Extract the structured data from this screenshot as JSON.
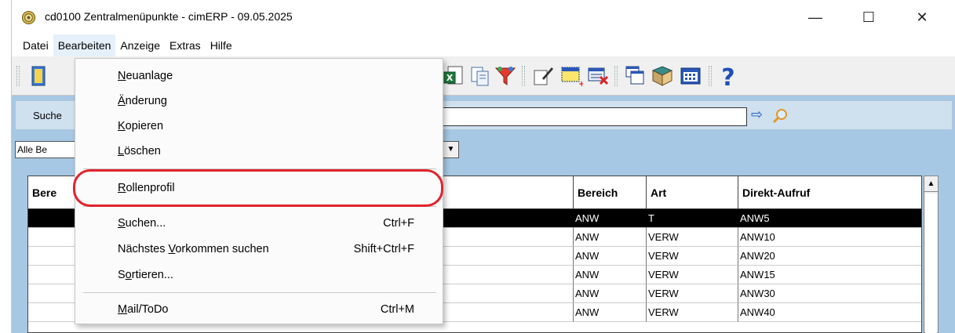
{
  "window": {
    "title": "cd0100 Zentralmenüpunkte - cimERP - 09.05.2025",
    "minimize_glyph": "—",
    "maximize_glyph": "☐",
    "close_glyph": "✕"
  },
  "menubar": {
    "items": [
      "Datei",
      "Bearbeiten",
      "Anzeige",
      "Extras",
      "Hilfe"
    ],
    "active": "Bearbeiten"
  },
  "dropdown": {
    "items": [
      {
        "label": "Neuanlage",
        "underline_char": "N",
        "shortcut": ""
      },
      {
        "label": "Änderung",
        "underline_char": "Ä",
        "shortcut": ""
      },
      {
        "label": "Kopieren",
        "underline_char": "K",
        "shortcut": ""
      },
      {
        "label": "Löschen",
        "underline_char": "L",
        "shortcut": ""
      },
      {
        "label": "Rollenprofil",
        "underline_char": "R",
        "shortcut": ""
      },
      {
        "label": "Suchen...",
        "underline_char": "S",
        "shortcut": "Ctrl+F"
      },
      {
        "label": "Nächstes Vorkommen suchen",
        "underline_char": "V",
        "shortcut": "Shift+Ctrl+F"
      },
      {
        "label": "Sortieren...",
        "underline_char": "o",
        "shortcut": ""
      },
      {
        "label": "Mail/ToDo",
        "underline_char": "M",
        "shortcut": "Ctrl+M"
      }
    ],
    "highlighted_item": "Rollenprofil",
    "highlight_color": "#e0242c"
  },
  "search": {
    "label_partial": "Suche",
    "value": "",
    "go_arrow": "⇨"
  },
  "filter": {
    "selected_partial": "Alle Be"
  },
  "grid": {
    "columns": [
      {
        "key": "name",
        "label_partial": "Bere"
      },
      {
        "key": "bereich",
        "label": "Bereich"
      },
      {
        "key": "art",
        "label": "Art"
      },
      {
        "key": "direkt",
        "label": "Direkt-Aufruf"
      }
    ],
    "rows": [
      {
        "bereich": "ANW",
        "art": "T",
        "direkt": "ANW5",
        "selected": true
      },
      {
        "bereich": "ANW",
        "art": "VERW",
        "direkt": "ANW10",
        "selected": false
      },
      {
        "bereich": "ANW",
        "art": "VERW",
        "direkt": "ANW20",
        "selected": false
      },
      {
        "bereich": "ANW",
        "art": "VERW",
        "direkt": "ANW15",
        "selected": false
      },
      {
        "bereich": "ANW",
        "art": "VERW",
        "direkt": "ANW30",
        "selected": false
      },
      {
        "bereich": "ANW",
        "art": "VERW",
        "direkt": "ANW40",
        "selected": false
      }
    ]
  },
  "colors": {
    "client_bg": "#a6c8e4",
    "selected_row_bg": "#000000",
    "menu_active_bg": "#e5f0fb"
  }
}
